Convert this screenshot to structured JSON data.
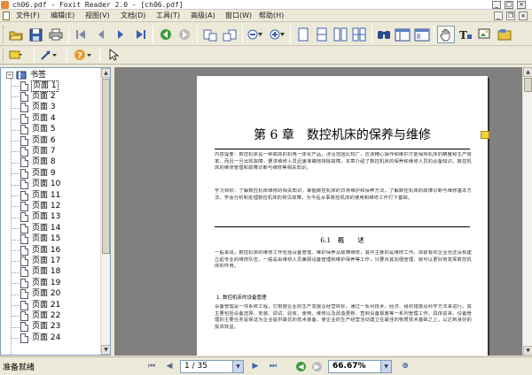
{
  "window": {
    "title": "ch06.pdf - Foxit Reader 2.0 - [ch06.pdf]"
  },
  "menu": [
    "文件(F)",
    "编辑(E)",
    "视图(V)",
    "文档(D)",
    "工具(T)",
    "高级(A)",
    "窗口(W)",
    "帮助(H)"
  ],
  "toolbar_icons": [
    "open-icon",
    "save-icon",
    "print-icon",
    "first-page-icon",
    "prev-page-icon",
    "next-page-icon",
    "last-page-icon",
    "go-back-icon",
    "go-forward-icon",
    "rotate-ccw-icon",
    "rotate-cw-icon",
    "zoom-out-icon",
    "zoom-in-icon",
    "single-page-icon",
    "continuous-icon",
    "facing-icon",
    "find-icon",
    "bookmark-panel-icon",
    "thumbnail-panel-icon",
    "hand-tool-icon",
    "text-select-icon",
    "snapshot-icon",
    "comment-icon"
  ],
  "toolbar2_icons": [
    "note-icon",
    "arrow-tool-icon",
    "help-icon",
    "select-icon"
  ],
  "sidebar": {
    "root_label": "书签",
    "items": [
      "页面 1",
      "页面 2",
      "页面 3",
      "页面 4",
      "页面 5",
      "页面 6",
      "页面 7",
      "页面 8",
      "页面 9",
      "页面 10",
      "页面 11",
      "页面 12",
      "页面 13",
      "页面 14",
      "页面 15",
      "页面 16",
      "页面 17",
      "页面 18",
      "页面 19",
      "页面 20",
      "页面 21",
      "页面 22",
      "页面 23",
      "页面 24"
    ],
    "selected_index": 0
  },
  "document": {
    "chapter_title": "第 6 章　数控机床的保养与维修",
    "summary": "内容提要：数控机床是一种高效的机电一体化产品，涉及范围比较广，应该精心操作和维护才能保持机床的精度和生产效率，而且一旦出现故障，要求维修人员迅速准确地排除故障，本章介绍了数控机床的保养和维修人员的必备知识，数控机床的维修管理和故障诊断与维修等相关知识。",
    "objective": "学习目标：了解数控机床维修的相关知识，掌握数控机床的日常维护和保养方法，了解数控机床的故障诊断与维修基本方法，学会分析和处理数控机床的常见故障，为今后从事数控机床的使用和维修工作打下基础。",
    "section_title": "6.1　概　　述",
    "body": "一般来说，数控机床的维修工作包括设备管理、维护保养及故障维修，其中主要的是维修工作。目前有的企业也还没有建立起专业的维修队伍，一般是由维修人员兼顾设备管理和维护保养等工作，只要对其加强管理，就可以更好地发挥数控机床的作用。",
    "sub_title": "1. 数控机床的设备管理",
    "body2": "设备管理是一项系统工程，它根据企业的生产发展及经营目标，通过一系列技术、经济、组织措施及科学方法来进行。其主要包括设备选择、安装、调试、验收、使用、维修以及改造更新、直到设备报废等一系列管理工作。具体说来，设备管理的主要任务是保证为企业提供最优的技术装备，使企业的生产经营活动建立在最佳的物质技术基础之上，以达到良好的投资效益。"
  },
  "status": {
    "text": "准备就绪",
    "page_field": "1 / 35",
    "zoom_field": "66.67%"
  }
}
